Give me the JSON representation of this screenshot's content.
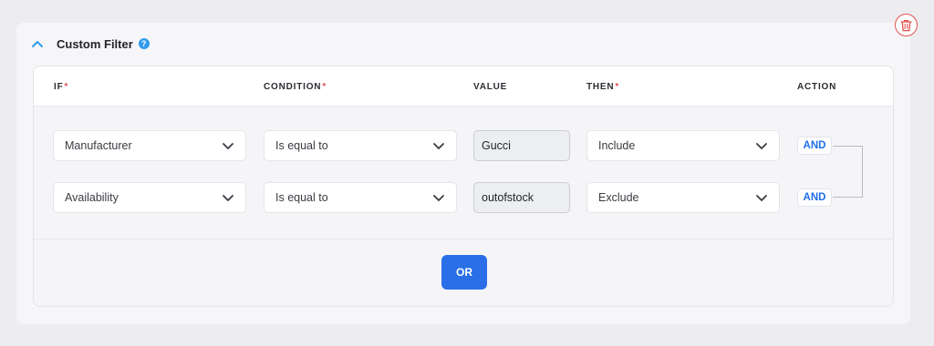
{
  "filter": {
    "title": "Custom Filter",
    "help_glyph": "?",
    "collapse_icon": "chevron-up-icon",
    "delete_icon": "trash-icon"
  },
  "table": {
    "headers": {
      "if": "IF",
      "condition": "CONDITION",
      "value": "VALUE",
      "then": "THEN",
      "action": "ACTION"
    },
    "required_marker": "*",
    "rows": [
      {
        "field": "Manufacturer",
        "condition": "Is equal to",
        "value": "Gucci",
        "then": "Include",
        "action": "AND"
      },
      {
        "field": "Availability",
        "condition": "Is equal to",
        "value": "outofstock",
        "then": "Exclude",
        "action": "AND"
      }
    ]
  },
  "or_button": "OR",
  "colors": {
    "accent_blue": "#2a6fe8",
    "required_red": "#e2504f",
    "help_blue": "#2f9bea"
  }
}
